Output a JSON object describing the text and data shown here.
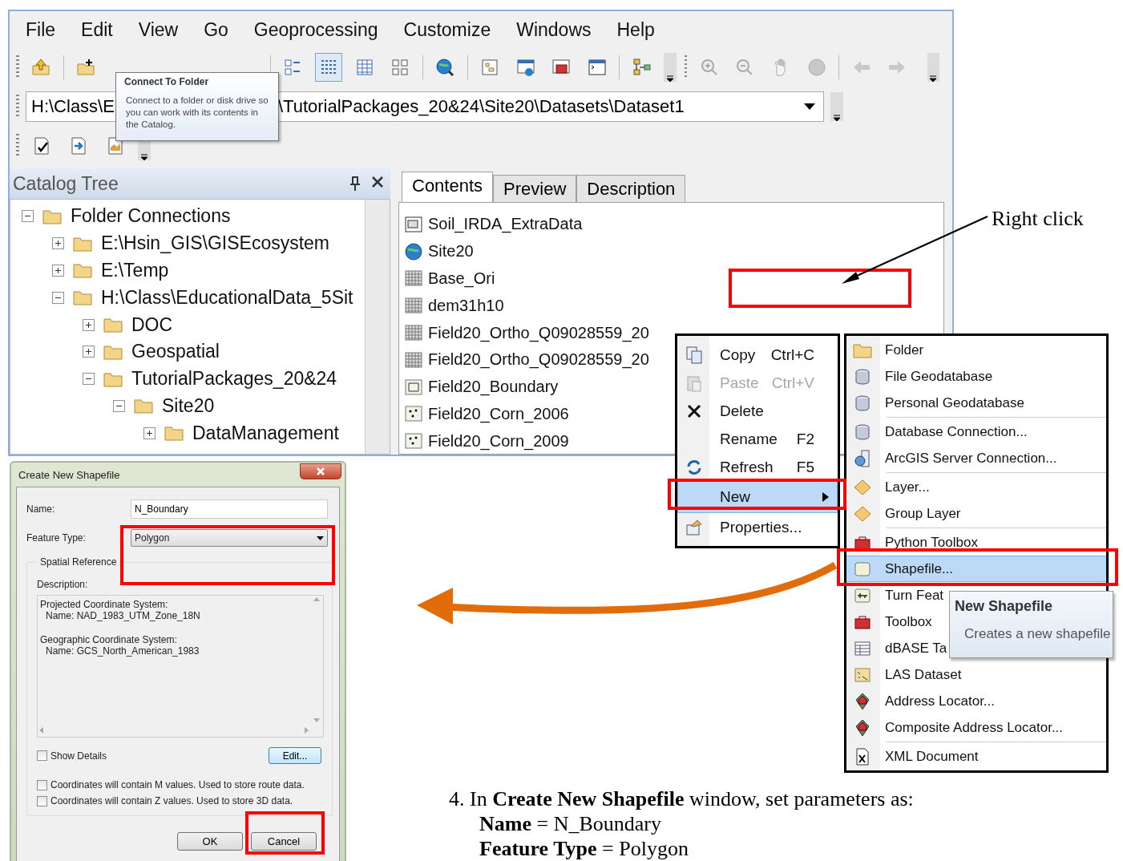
{
  "catalog_window": {
    "menu": [
      "File",
      "Edit",
      "View",
      "Go",
      "Geoprocessing",
      "Customize",
      "Windows",
      "Help"
    ],
    "location": {
      "value_start": "H:\\Class\\E",
      "value_end": "\\TutorialPackages_20&24\\Site20\\Datasets\\Dataset1"
    },
    "tooltip": {
      "title": "Connect To Folder",
      "text": "Connect to a folder or disk drive so you can work with its contents in the Catalog."
    },
    "catalog_tree": {
      "title": "Catalog Tree",
      "items": [
        {
          "label": "Folder Connections",
          "expanded": true,
          "children": [
            {
              "label": "E:\\Hsin_GIS\\GISEcosystem",
              "expanded": false
            },
            {
              "label": "E:\\Temp",
              "expanded": false
            },
            {
              "label": "H:\\Class\\EducationalData_5Sit",
              "expanded": true,
              "children": [
                {
                  "label": "DOC",
                  "expanded": false
                },
                {
                  "label": "Geospatial",
                  "expanded": false
                },
                {
                  "label": "TutorialPackages_20&24",
                  "expanded": true,
                  "children": [
                    {
                      "label": "Site20",
                      "expanded": true,
                      "children": [
                        {
                          "label": "DataManagement",
                          "expanded": false
                        }
                      ]
                    }
                  ]
                }
              ]
            }
          ]
        }
      ]
    },
    "tabs": [
      {
        "label": "Contents",
        "selected": true
      },
      {
        "label": "Preview",
        "selected": false
      },
      {
        "label": "Description",
        "selected": false
      }
    ],
    "contents": [
      {
        "name": "Soil_IRDA_ExtraData",
        "kind": "map"
      },
      {
        "name": "Site20",
        "kind": "globe"
      },
      {
        "name": "Base_Ori",
        "kind": "raster"
      },
      {
        "name": "dem31h10",
        "kind": "raster"
      },
      {
        "name": "Field20_Ortho_Q09028559_20",
        "kind": "raster"
      },
      {
        "name": "Field20_Ortho_Q09028559_20",
        "kind": "raster"
      },
      {
        "name": "Field20_Boundary",
        "kind": "polygon"
      },
      {
        "name": "Field20_Corn_2006",
        "kind": "point"
      },
      {
        "name": "Field20_Corn_2009",
        "kind": "point"
      }
    ]
  },
  "context_menu": [
    {
      "label": "Copy",
      "shortcut": "Ctrl+C",
      "kind": "copy",
      "disabled": false,
      "selected": false
    },
    {
      "label": "Paste",
      "shortcut": "Ctrl+V",
      "kind": "paste",
      "disabled": true,
      "selected": false
    },
    {
      "label": "Delete",
      "kind": "delete",
      "disabled": false,
      "selected": false
    },
    {
      "label": "Rename",
      "shortcut": "F2",
      "kind": "none",
      "disabled": false,
      "selected": false
    },
    {
      "label": "Refresh",
      "shortcut": "F5",
      "kind": "refresh",
      "disabled": false,
      "selected": false
    },
    {
      "label": "New",
      "kind": "submenu",
      "disabled": false,
      "selected": true
    },
    {
      "label": "Properties...",
      "kind": "properties",
      "disabled": false,
      "selected": false
    }
  ],
  "new_submenu": {
    "groups": [
      [
        {
          "label": "Folder",
          "kind": "folder",
          "selected": false
        },
        {
          "label": "File Geodatabase",
          "kind": "database",
          "selected": false
        },
        {
          "label": "Personal Geodatabase",
          "kind": "database",
          "selected": false
        }
      ],
      [
        {
          "label": "Database Connection...",
          "kind": "database",
          "selected": false
        },
        {
          "label": "ArcGIS Server Connection...",
          "kind": "server",
          "selected": false
        }
      ],
      [
        {
          "label": "Layer...",
          "kind": "layer",
          "selected": false
        },
        {
          "label": "Group Layer",
          "kind": "layer",
          "selected": false
        }
      ],
      [
        {
          "label": "Python Toolbox",
          "kind": "toolbox",
          "selected": false
        },
        {
          "label": "Shapefile...",
          "kind": "shapefile",
          "selected": true
        },
        {
          "label": "Turn Feat",
          "kind": "turn",
          "selected": false
        },
        {
          "label": "Toolbox",
          "kind": "toolbox",
          "selected": false
        },
        {
          "label": "dBASE Ta",
          "kind": "table",
          "selected": false
        },
        {
          "label": "LAS Dataset",
          "kind": "las",
          "selected": false
        },
        {
          "label": "Address Locator...",
          "kind": "locator",
          "selected": false
        },
        {
          "label": "Composite Address Locator...",
          "kind": "locator",
          "selected": false
        }
      ],
      [
        {
          "label": "XML Document",
          "kind": "xml",
          "selected": false
        }
      ]
    ],
    "tooltip": {
      "title": "New Shapefile",
      "text": "Creates a new shapefile"
    }
  },
  "dialog": {
    "title": "Create New Shapefile",
    "name_label": "Name:",
    "name_value": "N_Boundary",
    "feature_type_label": "Feature Type:",
    "feature_type_value": "Polygon",
    "group_label": "Spatial Reference",
    "description_label": "Description:",
    "description": [
      {
        "heading": "Projected Coordinate System:",
        "detail": "Name: NAD_1983_UTM_Zone_18N"
      },
      {
        "heading": "Geographic Coordinate System:",
        "detail": "Name: GCS_North_American_1983"
      }
    ],
    "show_details": {
      "label": "Show Details",
      "checked": false
    },
    "edit_button": "Edit...",
    "options": [
      {
        "label": "Coordinates will contain M values. Used to store route data.",
        "checked": false
      },
      {
        "label": "Coordinates will contain Z values. Used to store 3D data.",
        "checked": false
      }
    ],
    "buttons": [
      "OK",
      "Cancel"
    ]
  },
  "annotations": {
    "callout": "Right click",
    "instructions": [
      "4. In **Create New Shapefile** window, set parameters as:",
      "**Name** = N_Boundary",
      "**Feature Type** = Polygon"
    ]
  }
}
